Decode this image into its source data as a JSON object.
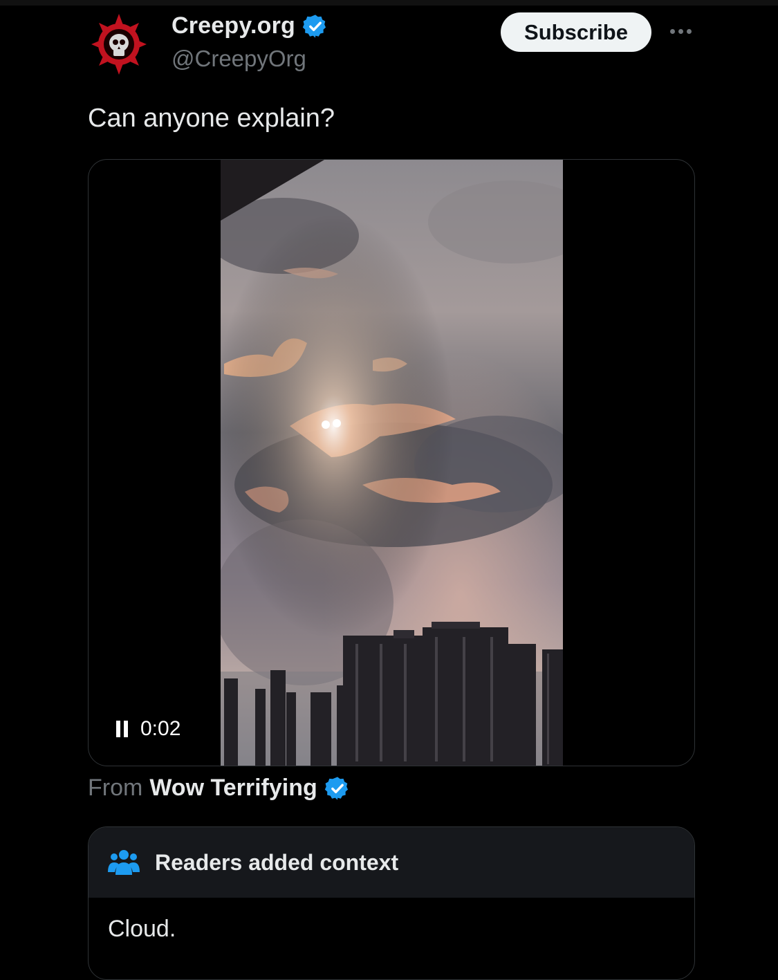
{
  "account": {
    "display_name": "Creepy.org",
    "handle": "@CreepyOrg",
    "verified_icon": "verified-badge-icon",
    "avatar_icon": "skull-emblem-icon"
  },
  "actions": {
    "subscribe_label": "Subscribe",
    "more_icon": "more-horizontal-icon"
  },
  "post": {
    "text": "Can anyone explain?"
  },
  "media": {
    "type": "video",
    "state_icon": "pause-icon",
    "elapsed": "0:02"
  },
  "attribution": {
    "from_label": "From",
    "source_name": "Wow Terrifying"
  },
  "community_note": {
    "header_icon": "people-icon",
    "title": "Readers added context",
    "body": "Cloud."
  },
  "colors": {
    "background": "#000000",
    "text_primary": "#e7e9ea",
    "text_secondary": "#71767b",
    "verified_blue": "#1d9bf0",
    "avatar_red": "#c1121f"
  }
}
